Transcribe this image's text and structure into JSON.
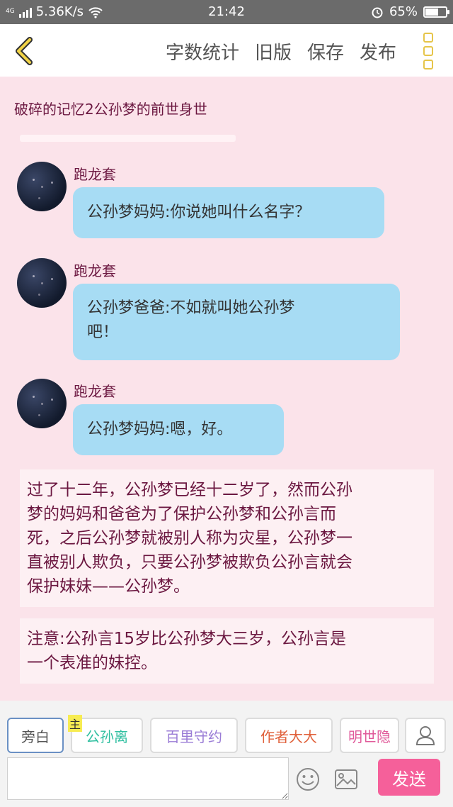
{
  "status_bar": {
    "network_type": "4G",
    "speed": "5.36K/s",
    "time": "21:42",
    "battery": "65%",
    "battery_level": 0.65
  },
  "toolbar": {
    "word_count_label": "字数统计",
    "old_version_label": "旧版",
    "save_label": "保存",
    "publish_label": "发布"
  },
  "document": {
    "title": "破碎的记忆2公孙梦的前世身世"
  },
  "messages": [
    {
      "speaker": "跑龙套",
      "text": "公孙梦妈妈:你说她叫什么名字？"
    },
    {
      "speaker": "跑龙套",
      "line1": "公孙梦爸爸:不如就叫她公孙梦",
      "line2": "吧！"
    },
    {
      "speaker": "跑龙套",
      "text": "公孙梦妈妈:嗯，好。"
    }
  ],
  "narrations": [
    {
      "lines": [
        "过了十二年，公孙梦已经十二岁了，然而公孙",
        "梦的妈妈和爸爸为了保护公孙梦和公孙言而",
        "死，之后公孙梦就被别人称为灾星，公孙梦一",
        "直被别人欺负，只要公孙梦被欺负公孙言就会",
        "保护妹妹——公孙梦。"
      ]
    },
    {
      "lines": [
        "注意:公孙言15岁比公孙梦大三岁，公孙言是",
        "一个表准的妹控。"
      ]
    }
  ],
  "roles": [
    {
      "label": "旁白",
      "color": "#555555",
      "selected": true
    },
    {
      "label": "公孙离",
      "color": "#2fbfa0",
      "badge": "主"
    },
    {
      "label": "百里守约",
      "color": "#9a7cd6"
    },
    {
      "label": "作者大大",
      "color": "#e0603a"
    },
    {
      "label": "明世隐",
      "color": "#e05a9a"
    }
  ],
  "composer": {
    "send_label": "发送",
    "input_value": ""
  },
  "colors": {
    "background": "#fbe3ea",
    "bubble": "#a7dcf4",
    "send": "#f5609a",
    "accent": "#e6c54a"
  }
}
